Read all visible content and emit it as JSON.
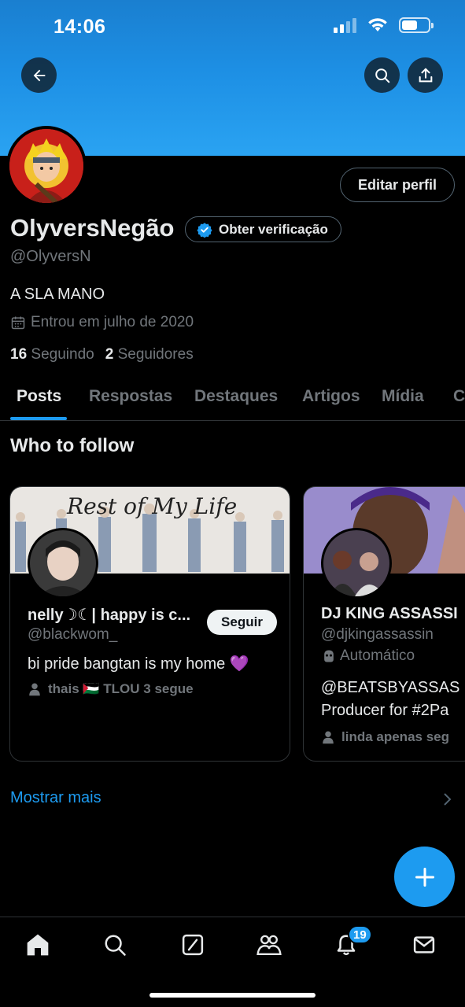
{
  "status_bar": {
    "time": "14:06"
  },
  "profile": {
    "name": "OlyversNegão",
    "verify_label": "Obter verificação",
    "edit_label": "Editar perfil",
    "handle": "@OlyversN",
    "bio": "A SLA MANO",
    "joined": "Entrou em julho de 2020",
    "following_count": "16",
    "following_label": "Seguindo",
    "followers_count": "2",
    "followers_label": "Seguidores"
  },
  "tabs": [
    {
      "label": "Posts"
    },
    {
      "label": "Respostas"
    },
    {
      "label": "Destaques"
    },
    {
      "label": "Artigos"
    },
    {
      "label": "Mídia"
    },
    {
      "label": "C"
    }
  ],
  "who_to_follow": {
    "title": "Who to follow",
    "cards": [
      {
        "banner_text": "Rest of My Life",
        "name": "nelly☽☾| happy is c...",
        "handle": "@blackwom_",
        "bio": "bi pride bangtan is my home 💜",
        "followed_by": "thais 🇵🇸 TLOU 3 segue",
        "follow_label": "Seguir"
      },
      {
        "name": "DJ KING ASSASSI",
        "handle": "@djkingassassin",
        "automated_label": "Automático",
        "bio_line1": "@BEATSBYASSAS",
        "bio_line2": "Producer for #2Pa",
        "followed_by": "linda apenas seg"
      }
    ],
    "show_more": "Mostrar mais"
  },
  "bottom_nav": {
    "notifications_badge": "19"
  },
  "colors": {
    "accent": "#1d9bf0",
    "background": "#000000",
    "muted": "#71767b",
    "text": "#e7e9ea"
  }
}
